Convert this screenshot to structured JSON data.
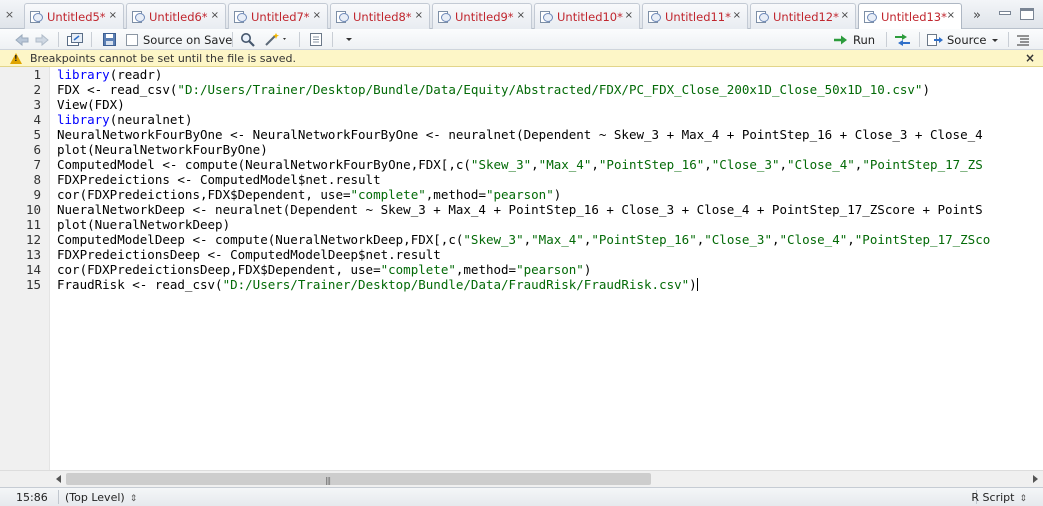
{
  "tabs": [
    {
      "label": "Untitled5*",
      "close": "×"
    },
    {
      "label": "Untitled6*",
      "close": "×"
    },
    {
      "label": "Untitled7*",
      "close": "×"
    },
    {
      "label": "Untitled8*",
      "close": "×"
    },
    {
      "label": "Untitled9*",
      "close": "×"
    },
    {
      "label": "Untitled10*",
      "close": "×"
    },
    {
      "label": "Untitled11*",
      "close": "×"
    },
    {
      "label": "Untitled12*",
      "close": "×"
    },
    {
      "label": "Untitled13*",
      "close": "×",
      "active": true
    }
  ],
  "tabbar": {
    "close_all": "×",
    "overflow": "»"
  },
  "toolbar": {
    "source_on_save_label": "Source on Save",
    "run_label": "Run",
    "source_label": "Source",
    "icons": [
      "back-arrow-icon",
      "forward-arrow-icon",
      "show-in-window-icon",
      "save-icon",
      "find-icon",
      "code-tools-wand-icon",
      "compile-report-icon",
      "options-dropdown-icon",
      "run-icon",
      "rerun-icon",
      "source-icon",
      "document-outline-icon"
    ]
  },
  "warning": {
    "text": "Breakpoints cannot be set until the file is saved.",
    "close": "×",
    "mark": "!"
  },
  "editor": {
    "line_numbers": [
      "1",
      "2",
      "3",
      "4",
      "5",
      "6",
      "7",
      "8",
      "9",
      "10",
      "11",
      "12",
      "13",
      "14",
      "15"
    ],
    "lines": [
      "library(readr)",
      "FDX <- read_csv(\"D:/Users/Trainer/Desktop/Bundle/Data/Equity/Abstracted/FDX/PC_FDX_Close_200x1D_Close_50x1D_10.csv\")",
      "View(FDX)",
      "library(neuralnet)",
      "NeuralNetworkFourByOne <- NeuralNetworkFourByOne <- neuralnet(Dependent ~ Skew_3 + Max_4 + PointStep_16 + Close_3 + Close_4",
      "plot(NeuralNetworkFourByOne)",
      "ComputedModel <- compute(NeuralNetworkFourByOne,FDX[,c(\"Skew_3\",\"Max_4\",\"PointStep_16\",\"Close_3\",\"Close_4\",\"PointStep_17_ZS",
      "FDXPredeictions <- ComputedModel$net.result",
      "cor(FDXPredeictions,FDX$Dependent, use=\"complete\",method=\"pearson\")",
      "NueralNetworkDeep <- neuralnet(Dependent ~ Skew_3 + Max_4 + PointStep_16 + Close_3 + Close_4 + PointStep_17_ZScore + PointS",
      "plot(NueralNetworkDeep)",
      "ComputedModelDeep <- compute(NueralNetworkDeep,FDX[,c(\"Skew_3\",\"Max_4\",\"PointStep_16\",\"Close_3\",\"Close_4\",\"PointStep_17_ZSco",
      "FDXPredeictionsDeep <- ComputedModelDeep$net.result",
      "cor(FDXPredeictionsDeep,FDX$Dependent, use=\"complete\",method=\"pearson\")",
      "FraudRisk <- read_csv(\"D:/Users/Trainer/Desktop/Bundle/Data/FraudRisk/FraudRisk.csv\")"
    ]
  },
  "status": {
    "position": "15:86",
    "scope": "(Top Level)",
    "scope_caret": "⇕",
    "language": "R Script",
    "language_caret": "⇕"
  },
  "colors": {
    "tab_text": "#c0262e",
    "keyword": "#0000ff",
    "string": "#036a07",
    "warning_bg": "#fdf6c7"
  }
}
